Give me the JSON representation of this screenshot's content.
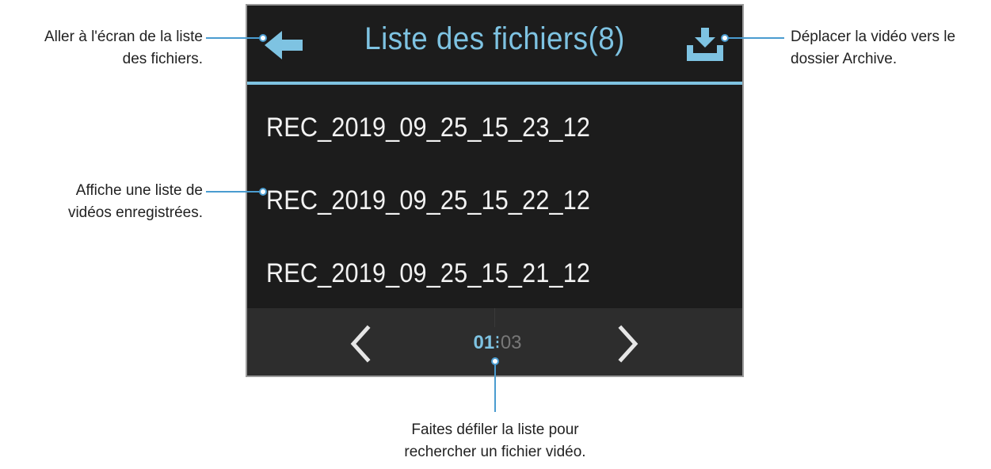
{
  "screen": {
    "title": "Liste des fichiers(8)",
    "back_icon": "arrow-left-icon",
    "archive_icon": "download-tray-icon",
    "files": [
      "REC_2019_09_25_15_23_12",
      "REC_2019_09_25_15_22_12",
      "REC_2019_09_25_15_21_12"
    ],
    "pager": {
      "current": "01",
      "separator": "⁝",
      "total": "03",
      "prev_icon": "chevron-left-icon",
      "next_icon": "chevron-right-icon"
    }
  },
  "callouts": {
    "back": {
      "line1": "Aller à l'écran de la liste",
      "line2": "des fichiers."
    },
    "archive": {
      "line1": "Déplacer la vidéo vers le",
      "line2": "dossier Archive."
    },
    "list": {
      "line1": "Affiche une liste de",
      "line2": "vidéos enregistrées."
    },
    "scroll": {
      "line1": "Faites défiler la liste pour",
      "line2": "rechercher un fichier vidéo."
    }
  },
  "colors": {
    "accent": "#7ec3e2",
    "callout": "#4a9cd0",
    "screen_bg": "#1c1c1c",
    "pager_bg": "#2d2d2d"
  }
}
